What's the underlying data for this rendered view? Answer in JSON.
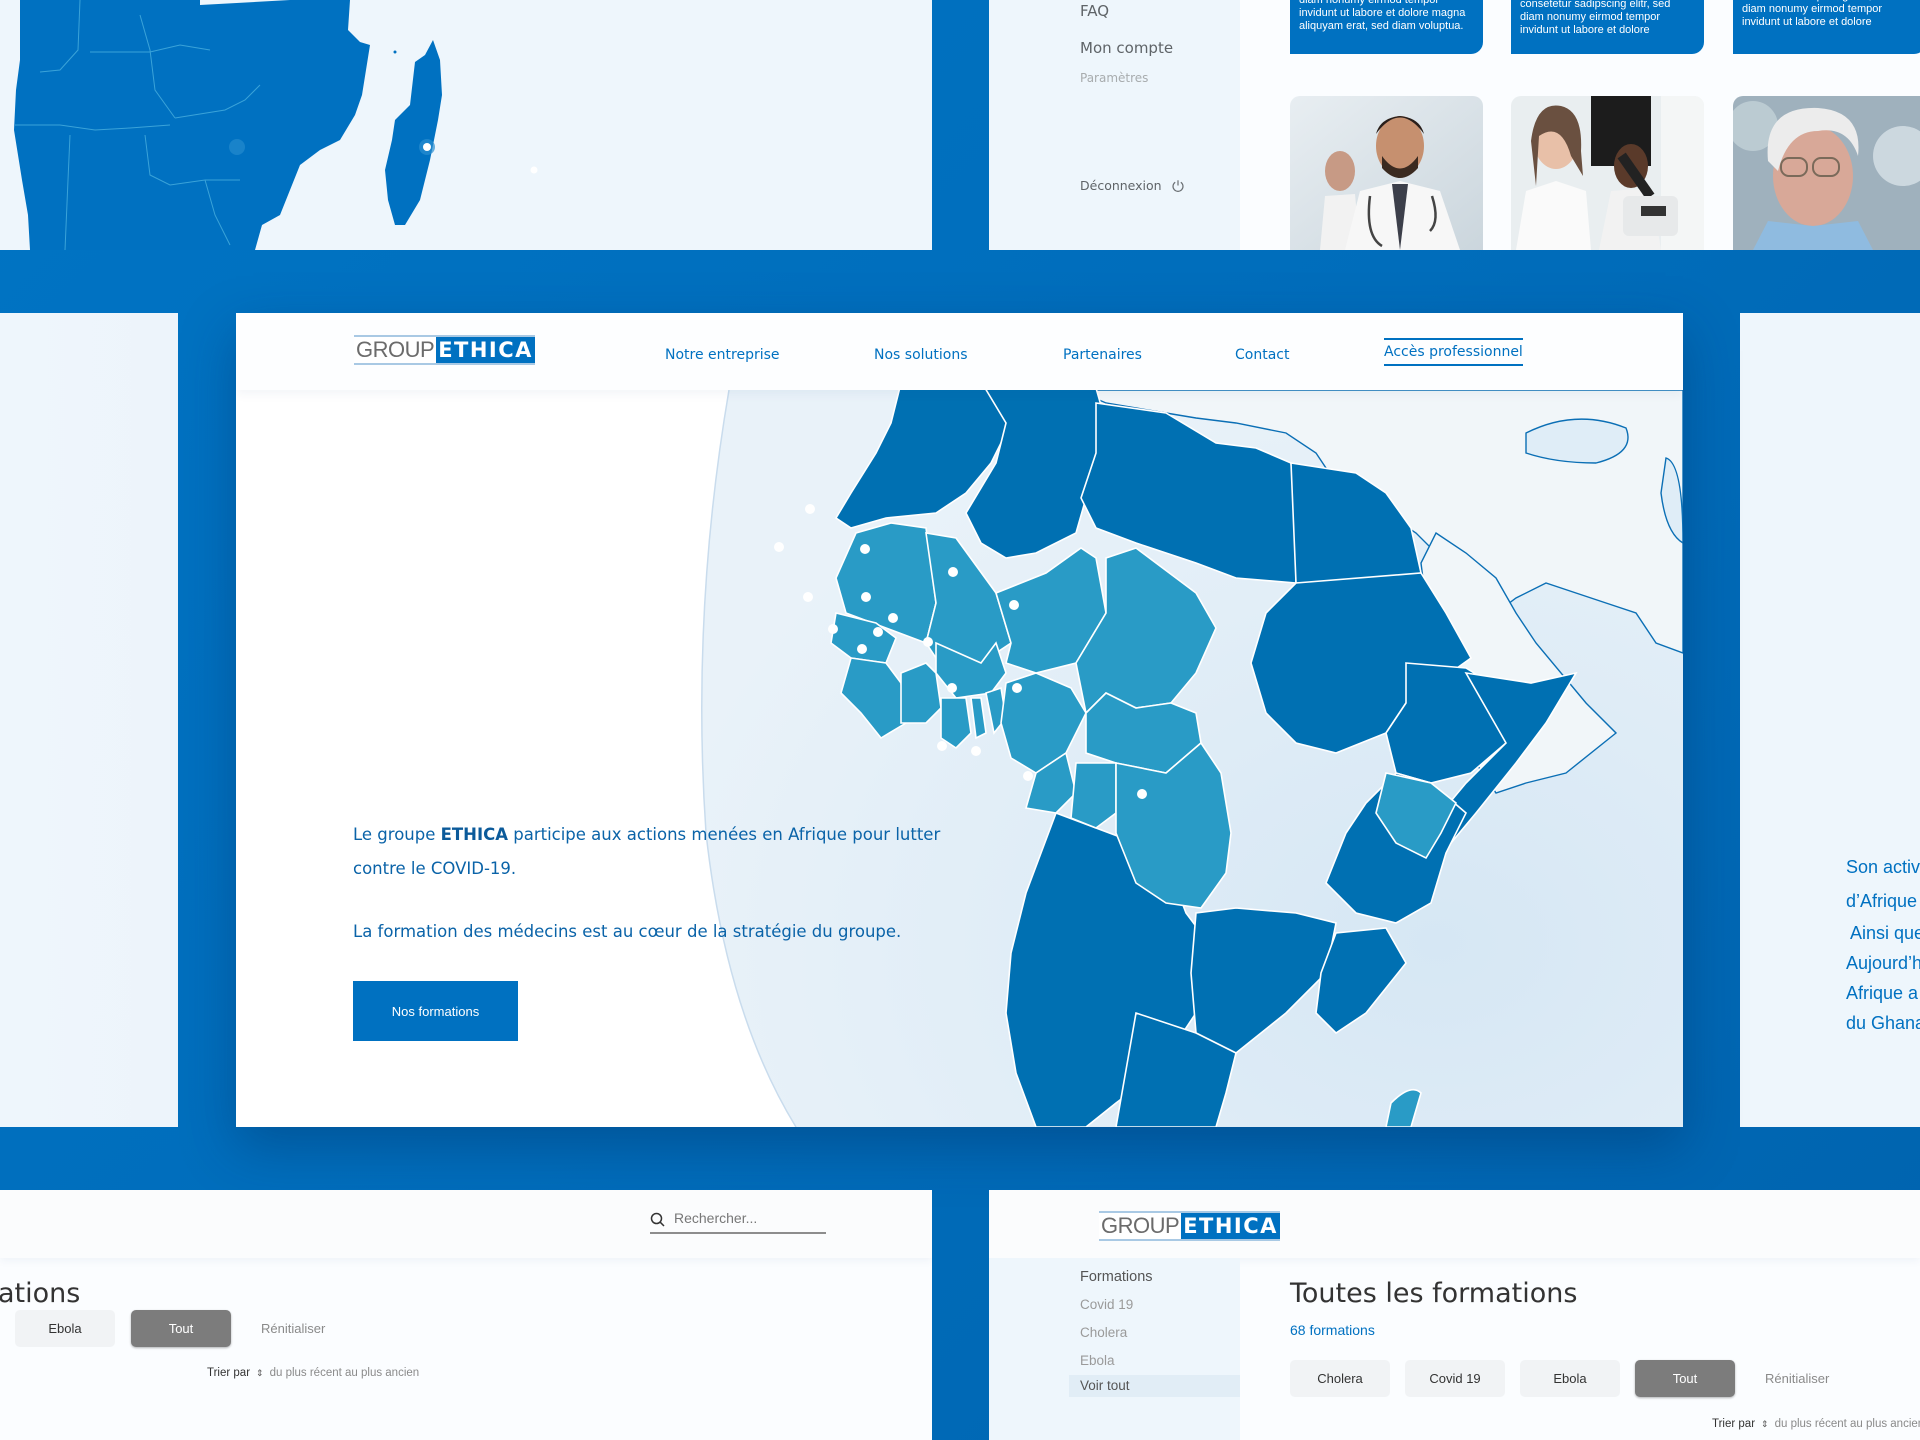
{
  "colors": {
    "brand_blue": "#0071c1",
    "background_blue": "#006dbb",
    "map_highlight": "#299bc6",
    "map_dark": "#0070b2",
    "map_other_land": "#f1f6f9",
    "map_sea": "#dfedf7",
    "panel_light": "#eef6fc"
  },
  "logo": {
    "part1": "GROUP",
    "part2": "ETHICA"
  },
  "top_left_panel": {
    "map_region": "Southern Africa and Madagascar"
  },
  "top_right_panel": {
    "sidebar": {
      "items": [
        {
          "label": "FAQ"
        },
        {
          "label": "Mon compte"
        },
        {
          "label": "Paramètres"
        }
      ],
      "logout": {
        "label": "Déconnexion",
        "icon": "power-icon"
      }
    },
    "cards": [
      {
        "text": "diam nonumy eirmod tempor invidunt ut labore et dolore magna aliquyam erat, sed diam voluptua."
      },
      {
        "text": "consetetur sadipscing elitr, sed diam nonumy eirmod tempor invidunt ut labore et dolore"
      },
      {
        "text": "consetetur sadipscing elitr, sed diam nonumy eirmod tempor invidunt ut labore et dolore"
      }
    ],
    "photos": [
      {
        "alt": "Smiling male doctor with stethoscope"
      },
      {
        "alt": "Smiling female lab scientist with microscope"
      },
      {
        "alt": "Elderly man with glasses"
      }
    ]
  },
  "main_panel": {
    "nav": [
      {
        "label": "Notre entreprise"
      },
      {
        "label": "Nos solutions"
      },
      {
        "label": "Partenaires"
      },
      {
        "label": "Contact"
      },
      {
        "label": "Accès professionnel",
        "active": true
      }
    ],
    "hero": {
      "line1_prefix": "Le groupe ",
      "line1_brand": "ETHICA",
      "line1_suffix": " participe aux actions menées en Afrique pour lutter contre le COVID-19.",
      "line2": "La formation des médecins est au cœur de la stratégie du groupe."
    },
    "cta_label": "Nos formations",
    "map_region": "Africa, Europe and Middle East with highlighted countries"
  },
  "right_panel": {
    "lines": [
      "Son activ",
      "d’Afrique",
      "Ainsi que",
      "Aujourd’h",
      "Afrique a",
      "du Ghana"
    ]
  },
  "bottom_left_panel": {
    "search": {
      "placeholder": "Rechercher...",
      "icon": "search-icon"
    },
    "title": "ations",
    "chips": [
      {
        "label": "Ebola"
      },
      {
        "label": "Tout",
        "active": true
      }
    ],
    "reset_label": "Rénitialiser",
    "sort": {
      "label": "Trier par",
      "value": "du plus récent au plus ancien"
    }
  },
  "bottom_right_panel": {
    "sidebar": {
      "heading": "Formations",
      "items": [
        {
          "label": "Covid 19"
        },
        {
          "label": "Cholera"
        },
        {
          "label": "Ebola"
        },
        {
          "label": "Voir tout",
          "selected": true
        }
      ]
    },
    "title": "Toutes les formations",
    "count": "68 formations",
    "chips": [
      {
        "label": "Cholera"
      },
      {
        "label": "Covid 19"
      },
      {
        "label": "Ebola"
      },
      {
        "label": "Tout",
        "active": true
      }
    ],
    "reset_label": "Rénitialiser",
    "sort": {
      "label": "Trier par",
      "value": "du plus récent au plus ancien"
    }
  }
}
